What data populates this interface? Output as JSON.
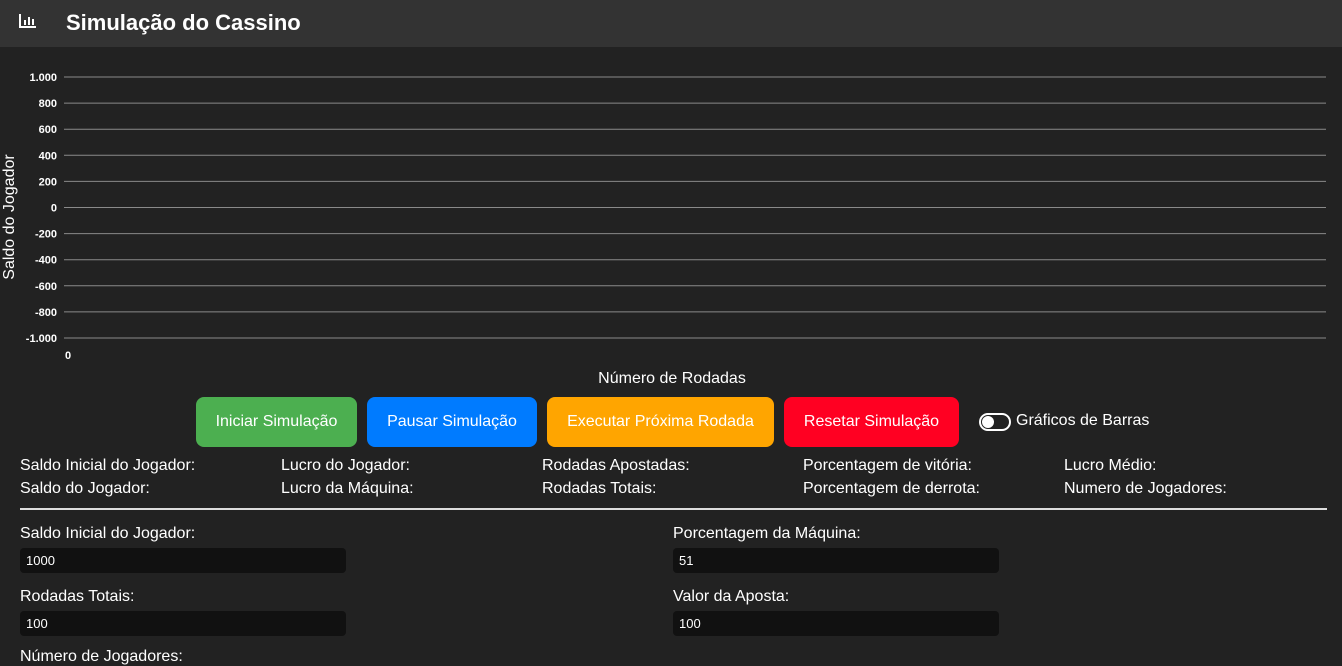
{
  "header": {
    "title": "Simulação do Cassino",
    "icon": "bar-chart-icon"
  },
  "chart_data": {
    "type": "line",
    "ylabel": "Saldo do Jogador",
    "xlabel": "Número de Rodadas",
    "y_ticks": [
      "1.000",
      "800",
      "600",
      "400",
      "200",
      "0",
      "-200",
      "-400",
      "-600",
      "-800",
      "-1.000"
    ],
    "x_ticks": [
      "0"
    ],
    "ylim": [
      -1000,
      1000
    ],
    "grid": true,
    "series": []
  },
  "controls": {
    "start": "Iniciar Simulação",
    "pause": "Pausar Simulação",
    "next": "Executar Próxima Rodada",
    "reset": "Resetar Simulação",
    "toggle_label": "Gráficos de Barras",
    "colors": {
      "start": "#4caf50",
      "pause": "#007bff",
      "next": "#ffa500",
      "reset": "#ff0022"
    }
  },
  "stats": {
    "saldo_inicial": "Saldo Inicial do Jogador:",
    "saldo_jogador": "Saldo do Jogador:",
    "lucro_jogador": "Lucro do Jogador:",
    "lucro_maquina": "Lucro da Máquina:",
    "rodadas_apostadas": "Rodadas Apostadas:",
    "rodadas_totais": "Rodadas Totais:",
    "porc_vitoria": "Porcentagem de vitória:",
    "porc_derrota": "Porcentagem de derrota:",
    "lucro_medio": "Lucro Médio:",
    "num_jogadores": "Numero de Jogadores:"
  },
  "form": {
    "saldo_inicial_label": "Saldo Inicial do Jogador:",
    "saldo_inicial_value": "1000",
    "porc_maquina_label": "Porcentagem da Máquina:",
    "porc_maquina_value": "51",
    "rodadas_totais_label": "Rodadas Totais:",
    "rodadas_totais_value": "100",
    "valor_aposta_label": "Valor da Aposta:",
    "valor_aposta_value": "100",
    "num_jogadores_label": "Número de Jogadores:"
  }
}
